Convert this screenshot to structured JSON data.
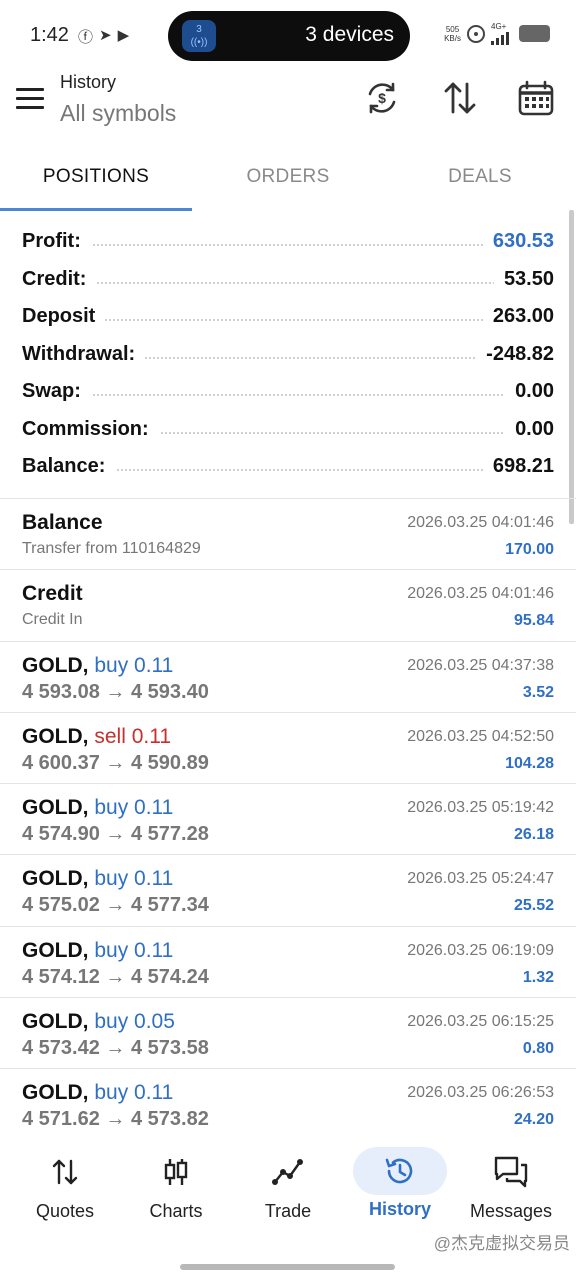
{
  "status_bar": {
    "time": "1:42",
    "notification_icons": [
      "facebook-icon",
      "telegram-icon",
      "play-icon"
    ],
    "live_pill": {
      "app_badge": "3",
      "label": "3 devices"
    },
    "net_speed_value": "505",
    "net_speed_unit": "KB/s",
    "network": "4G+"
  },
  "header": {
    "title": "History",
    "subtitle": "All symbols"
  },
  "tabs": [
    {
      "label": "POSITIONS",
      "active": true
    },
    {
      "label": "ORDERS",
      "active": false
    },
    {
      "label": "DEALS",
      "active": false
    }
  ],
  "summary": [
    {
      "label": "Profit:",
      "value": "630.53",
      "highlight": true
    },
    {
      "label": "Credit:",
      "value": "53.50"
    },
    {
      "label": "Deposit",
      "value": "263.00"
    },
    {
      "label": "Withdrawal:",
      "value": "-248.82"
    },
    {
      "label": "Swap:",
      "value": "0.00"
    },
    {
      "label": "Commission:",
      "value": "0.00"
    },
    {
      "label": "Balance:",
      "value": "698.21"
    }
  ],
  "deals": [
    {
      "symbol": "Balance",
      "direction": "",
      "direction_type": "",
      "sub": "Transfer from 110164829",
      "prices": "",
      "datetime": "2026.03.25 04:01:46",
      "profit": "170.00"
    },
    {
      "symbol": "Credit",
      "direction": "",
      "direction_type": "",
      "sub": "Credit In",
      "prices": "",
      "datetime": "2026.03.25 04:01:46",
      "profit": "95.84"
    },
    {
      "symbol": "GOLD,",
      "direction": "buy 0.11",
      "direction_type": "buy",
      "sub": "",
      "prices": "4 593.08 → 4 593.40",
      "datetime": "2026.03.25 04:37:38",
      "profit": "3.52"
    },
    {
      "symbol": "GOLD,",
      "direction": "sell 0.11",
      "direction_type": "sell",
      "sub": "",
      "prices": "4 600.37 → 4 590.89",
      "datetime": "2026.03.25 04:52:50",
      "profit": "104.28"
    },
    {
      "symbol": "GOLD,",
      "direction": "buy 0.11",
      "direction_type": "buy",
      "sub": "",
      "prices": "4 574.90 → 4 577.28",
      "datetime": "2026.03.25 05:19:42",
      "profit": "26.18"
    },
    {
      "symbol": "GOLD,",
      "direction": "buy 0.11",
      "direction_type": "buy",
      "sub": "",
      "prices": "4 575.02 → 4 577.34",
      "datetime": "2026.03.25 05:24:47",
      "profit": "25.52"
    },
    {
      "symbol": "GOLD,",
      "direction": "buy 0.11",
      "direction_type": "buy",
      "sub": "",
      "prices": "4 574.12 → 4 574.24",
      "datetime": "2026.03.25 06:19:09",
      "profit": "1.32"
    },
    {
      "symbol": "GOLD,",
      "direction": "buy 0.05",
      "direction_type": "buy",
      "sub": "",
      "prices": "4 573.42 → 4 573.58",
      "datetime": "2026.03.25 06:15:25",
      "profit": "0.80"
    },
    {
      "symbol": "GOLD,",
      "direction": "buy 0.11",
      "direction_type": "buy",
      "sub": "",
      "prices": "4 571.62 → 4 573.82",
      "datetime": "2026.03.25 06:26:53",
      "profit": "24.20"
    }
  ],
  "bottom_nav": [
    {
      "label": "Quotes",
      "icon": "quotes-arrows-icon",
      "active": false
    },
    {
      "label": "Charts",
      "icon": "candlestick-icon",
      "active": false
    },
    {
      "label": "Trade",
      "icon": "trade-line-icon",
      "active": false
    },
    {
      "label": "History",
      "icon": "history-clock-icon",
      "active": true
    },
    {
      "label": "Messages",
      "icon": "messages-icon",
      "active": false
    }
  ],
  "watermark": "@杰克虚拟交易员",
  "colors": {
    "accent_blue": "#2f6fc4",
    "sell_red": "#c62f2f",
    "tab_underline": "#4a88d6",
    "muted_text": "#777777"
  }
}
